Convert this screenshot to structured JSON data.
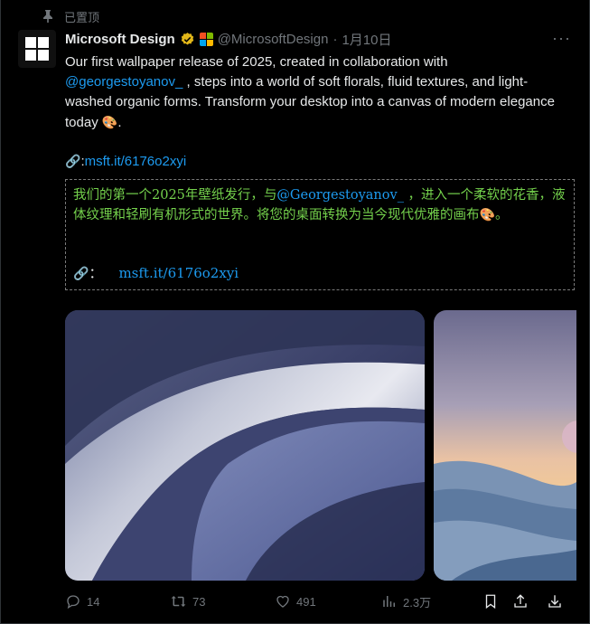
{
  "pinned": {
    "label": "已置顶"
  },
  "author": {
    "display_name": "Microsoft Design",
    "handle": "@MicrosoftDesign",
    "separator": "·",
    "date": "1月10日",
    "verified_color": "#e2b719"
  },
  "tweet": {
    "text_before": "Our first wallpaper release of 2025, created in collaboration with ",
    "mention": "@georgestoyanov_",
    "text_after": " , steps into a world of soft florals, fluid textures, and light-washed organic forms. Transform your desktop into a canvas of modern elegance today ",
    "emoji": "🎨",
    "end": ".",
    "link_emoji": "🔗",
    "link_colon": ":",
    "link": "msft.it/6176o2xyi"
  },
  "translation": {
    "line_before": "我们的第一个2025年壁纸发行，与",
    "mention": "@Georgestoyanov_",
    "line_after": " ，进入一个柔软的花香，液体纹理和轻刷有机形式的世界。将您的桌面转换为当今现代优雅的画布",
    "emoji": "🎨",
    "end": "。",
    "link_emoji": "🔗",
    "link_colon": "：",
    "link": "msft.it/6176o2xyi"
  },
  "actions": {
    "replies": "14",
    "reposts": "73",
    "likes": "491",
    "views": "2.3万"
  },
  "colors": {
    "accent": "#1d9bf0",
    "translation_text": "#74d14c",
    "muted": "#71767b",
    "background": "#000000"
  }
}
